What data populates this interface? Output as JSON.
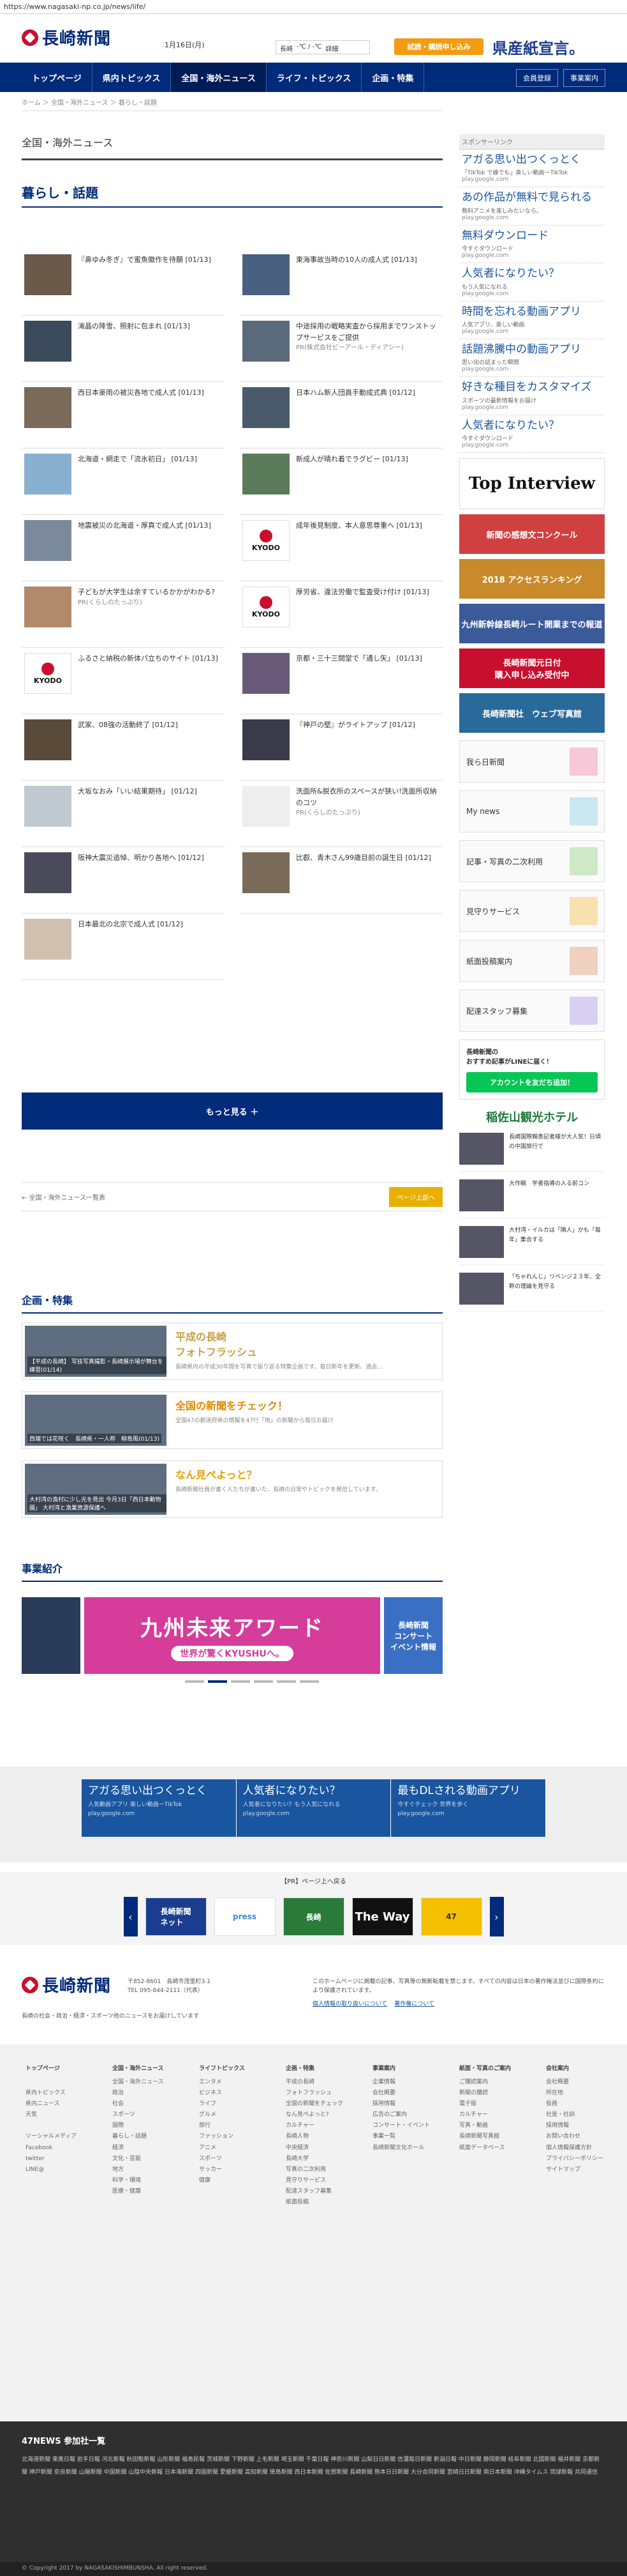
{
  "url": "https://www.nagasaki-np.co.jp/news/life/",
  "header": {
    "logo_text": "長崎新聞",
    "date": "1月16日(月)",
    "weather_label": "長崎",
    "weather_temp": "-℃ / -℃",
    "weather_link": "詳細",
    "trial_button": "試読・購読申し込み",
    "campaign": "県産紙宣言。"
  },
  "nav": {
    "items": [
      "トップページ",
      "県内トピックス",
      "全国・海外ニュース",
      "ライフ・トピックス",
      "企画・特集"
    ],
    "member": "会員登録",
    "shop": "事業案内"
  },
  "breadcrumb": "ホーム ＞ 全国・海外ニュース ＞ 暮らし・話題",
  "section_heading": "全国・海外ニュース",
  "category_title": "暮らし・話題",
  "articles": [
    {
      "text": "『鼻ゆみ冬ぎ』で蜜魚徽作を待願",
      "date": "[01/13]",
      "kind": "photo"
    },
    {
      "text": "東海事故当時の10人の成人式",
      "date": "[01/13]",
      "kind": "photo"
    },
    {
      "text": "滝晶の降雪、照射に包まれ",
      "date": "[01/13]",
      "kind": "photo"
    },
    {
      "text": "中途採用の戦略実査から採用までワンストップサービスをご提供",
      "date": "PR(株式会社ビーアール・ディアシー)",
      "kind": "photo"
    },
    {
      "text": "西日本豪雨の被災各地で成人式",
      "date": "[01/13]",
      "kind": "photo"
    },
    {
      "text": "日本ハム新人団員手動成式典",
      "date": "[01/12]",
      "kind": "photo"
    },
    {
      "text": "北海道・網走で「流氷初日」",
      "date": "[01/13]",
      "kind": "photo"
    },
    {
      "text": "新成人が晴れ着でラグビー",
      "date": "[01/13]",
      "kind": "photo"
    },
    {
      "text": "地震被災の北海道・厚真で成人式",
      "date": "[01/13]",
      "kind": "photo"
    },
    {
      "text": "成年後見制度、本人意思尊重へ",
      "date": "[01/13]",
      "kind": "kyodo"
    },
    {
      "text": "子どもが大学生は余すているかかがわかる?",
      "date": "PR(くらしのたっぷり)",
      "kind": "photo"
    },
    {
      "text": "厚労省、違法労働で監査受け付け",
      "date": "[01/13]",
      "kind": "kyodo"
    },
    {
      "text": "ふるさと納税の新体パ立ちのサイト",
      "date": "[01/13]",
      "kind": "kyodo"
    },
    {
      "text": "京都・三十三間堂で「通し矢」",
      "date": "[01/13]",
      "kind": "photo"
    },
    {
      "text": "武家、08強の活動終了",
      "date": "[01/12]",
      "kind": "photo"
    },
    {
      "text": "『神戸の壁』がライトアップ",
      "date": "[01/12]",
      "kind": "photo"
    },
    {
      "text": "大坂なおみ「いい結果期待」",
      "date": "[01/12]",
      "kind": "photo"
    },
    {
      "text": "洗面所&脱衣所のスペースが狭い!洗面所収納のコツ",
      "date": "PR(くらしのたっぷり)",
      "kind": "photo"
    },
    {
      "text": "阪神大震災追悼、明かり各地へ",
      "date": "[01/12]",
      "kind": "photo"
    },
    {
      "text": "比叡、青木さん99歳目前の誕生日",
      "date": "[01/12]",
      "kind": "photo"
    },
    {
      "text": "日本最北の北宗で成人式",
      "date": "[01/12]",
      "kind": "photo"
    }
  ],
  "more_button": "もっと見る ＋",
  "pager": {
    "back": "← 全国・海外ニュース一覧表",
    "top": "ページ上部へ"
  },
  "features": {
    "title": "企画・特集",
    "items": [
      {
        "title": "平成の長崎\nフォトフラッシュ",
        "desc": "長崎県内の平成30年間を写真で振り返る特集企画です。毎日新年を更新、過去…",
        "caption": "【平成の長崎】 写技写真撮影・長崎展示場が舞台を練習(01/14)"
      },
      {
        "title": "全国の新聞をチェック！",
        "desc": "全国47の都道府県の情報を47行「地」の新聞から毎日お届け",
        "caption": "西端では花咲く　長崎県・一人称　柳島風(01/13)"
      },
      {
        "title": "なん見ぺよっと？",
        "desc": "長崎新聞社員が書く人たちが書いた、長崎の日常やトピックを発信しています。",
        "caption": "大村湾の漁村に少し光を見出 今月3日「西日本動物園」 大村湾と漁業資源保護へ"
      }
    ]
  },
  "biz": {
    "title": "事業紹介",
    "main": "九州未来アワード",
    "main_sub": "世界が驚くKYUSHUへ。",
    "side": "長崎新聞\nコンサート\nイベント情報"
  },
  "bottom_ads": [
    {
      "title": "アガる思い出つくっとく",
      "desc": "人気動画アプリ 楽しい動画ーTikTok",
      "url": "play.google.com"
    },
    {
      "title": "人気者になりたい？",
      "desc": "人気者になりたい？もう人気になれる",
      "url": "play.google.com"
    },
    {
      "title": "最もDLされる動画アプリ",
      "desc": "今すぐチェック 世界を歩く",
      "url": "play.google.com"
    }
  ],
  "pr_label": "【PR】ページ上へ戻る",
  "logo_strip": [
    "長崎新聞\nネット",
    "press",
    "長崎",
    "The Way",
    "47"
  ],
  "footer": {
    "logo": "長崎新聞",
    "address": "〒852-8601　長崎市茂里町3-1\nTEL 095-844-2111（代表）",
    "note": "このホームページに掲載の記事、写真等の無断転載を禁じます。すべての内容は日本の著作権法並びに国際条約により保護されています。",
    "sub": "長崎の社会・政治・経済・スポーツ他のニュースをお届けしています",
    "policy": "個人情報の取り扱いについて",
    "privacy": "著作権について"
  },
  "sitemap": [
    {
      "h": "トップページ",
      "items": [
        "",
        "県内トピックス",
        "県内ニュース",
        "天気",
        "",
        "ソーシャルメディア",
        "Facebook",
        "twitter",
        "LINE@"
      ]
    },
    {
      "h": "全国・海外ニュース",
      "items": [
        "全国・海外ニュース",
        "政治",
        "社会",
        "スポーツ",
        "国際",
        "暮らし・話題",
        "経済",
        "文化・芸能",
        "地方",
        "科学・環境",
        "医療・健康"
      ]
    },
    {
      "h": "ライフトピックス",
      "items": [
        "エンタメ",
        "ビジネス",
        "ライフ",
        "グルメ",
        "旅行",
        "ファッション",
        "アニメ",
        "スポーツ",
        "サッカー",
        "健康"
      ]
    },
    {
      "h": "企画・特集",
      "items": [
        "平成の長崎",
        "フォトフラッシュ",
        "全国の新聞をチェック",
        "なん見ぺよっと?",
        "カルチャー",
        "長崎人物",
        "中央経済",
        "長崎大学",
        "写真の二次利用",
        "見守りサービス",
        "配達スタッフ募集",
        "紙面投稿"
      ]
    },
    {
      "h": "事業案内",
      "items": [
        "企業情報",
        "会社概要",
        "採用情報",
        "広告のご案内",
        "コンサート・イベント",
        "事業一覧",
        "長崎新聞文化ホール"
      ]
    },
    {
      "h": "紙面・写真のご案内",
      "items": [
        "ご購読案内",
        "新聞の購読",
        "電子版",
        "カルチャー",
        "写真・動画",
        "長崎新聞写真館",
        "紙面データベース"
      ]
    },
    {
      "h": "会社案内",
      "items": [
        "会社概要",
        "所在地",
        "役員",
        "社是・社訓",
        "採用情報",
        "お問い合わせ",
        "個人情報保護方針",
        "プライバシーポリシー",
        "サイトマップ"
      ]
    }
  ],
  "site47": {
    "title": "47NEWS 参加社一覧",
    "list": "北海道新聞 東奥日報 岩手日報 河北新報 秋田魁新報 山形新聞 福島民報 茨城新聞 下野新聞 上毛新聞 埼玉新聞 千葉日報 神奈川新聞 山梨日日新聞 信濃毎日新聞 新潟日報 中日新聞 静岡新聞 岐阜新聞 北國新聞 福井新聞 京都新聞 神戸新聞 奈良新聞 山陽新聞 中国新聞 山陰中央新報 日本海新聞 四国新聞 愛媛新聞 高知新聞 徳島新聞 西日本新聞 佐賀新聞 長崎新聞 熊本日日新聞 大分合同新聞 宮崎日日新聞 南日本新聞 沖縄タイムス 琉球新報 共同通信"
  },
  "copyright": "© Copyright 2017 by NAGASAKISHIMBUNSHA. All right reserved.",
  "sidebar": {
    "sponsor_label": "スポンサーリンク",
    "ads": [
      {
        "title": "アガる思い出つくっとく",
        "desc": "「TikTok で誰でも」楽しい動画ーTikTok",
        "url": "play.google.com"
      },
      {
        "title": "あの作品が無料で見られる",
        "desc": "無料アニメを楽しみたいなら。",
        "url": "play.google.com"
      },
      {
        "title": "無料ダウンロード",
        "desc": "今すぐダウンロード",
        "url": "play.google.com"
      },
      {
        "title": "人気者になりたい？",
        "desc": "もう人気になれる",
        "url": "play.google.com"
      },
      {
        "title": "時間を忘れる動画アプリ",
        "desc": "人気アプリ、楽しい動画",
        "url": "play.google.com"
      },
      {
        "title": "話題沸騰中の動画アプリ",
        "desc": "思い出の詰まった瞬間",
        "url": "play.google.com"
      },
      {
        "title": "好きな種目をカスタマイズ",
        "desc": "スポーツの最新情報をお届け",
        "url": "play.google.com"
      },
      {
        "title": "人気者になりたい？",
        "desc": "今すぐダウンロード",
        "url": "play.google.com"
      }
    ],
    "banners": [
      {
        "text": "Top Interview",
        "color": "#ffffff"
      },
      {
        "text": "新聞の感想文コンクール",
        "color": "#d04040"
      },
      {
        "text": "2018 アクセスランキング",
        "color": "#c88a2a"
      },
      {
        "text": "九州新幹線長崎ルート開業までの報道",
        "color": "#3a5a9a"
      },
      {
        "text": "長崎新聞元日付\n購入申し込み受付中",
        "color": "#c8102e"
      },
      {
        "text": "長崎新聞社　ウェブ写真館",
        "color": "#2a6a9a"
      }
    ],
    "links": [
      "我ら日新聞",
      "My news",
      "記事・写真の二次利用",
      "見守りサービス",
      "紙面投稿案内",
      "配達スタッフ募集"
    ],
    "line_title": "長崎新聞の\nおすすめ記事がLINEに届く！",
    "line_button": "アカウントを友だち追加！",
    "hotel": "稲佐山観光ホテル",
    "news": [
      {
        "text": "長崎国際親善記者様が大人気！日頃の中国旅行で"
      },
      {
        "text": "大作戦　学者指導の入る前コン"
      },
      {
        "text": "大村湾・イルカは「隣人」かも「毎年」集合する"
      },
      {
        "text": "「ちゃれんじ」リベンジ２３年、全幹の理論を見守る"
      }
    ]
  }
}
